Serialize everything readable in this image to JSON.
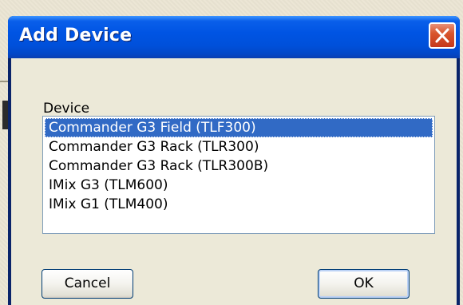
{
  "dialog": {
    "title": "Add Device",
    "field_label": "Device",
    "devices": [
      "Commander G3 Field (TLF300)",
      "Commander G3 Rack (TLR300)",
      "Commander G3 Rack (TLR300B)",
      "IMix G3 (TLM600)",
      "IMix G1 (TLM400)"
    ],
    "selected_device": "Commander G3 Field (TLF300)",
    "cancel_label": "Cancel",
    "ok_label": "OK"
  },
  "icons": {
    "close": "close-icon"
  },
  "colors": {
    "titlebar": "#0054e3",
    "selection": "#316ac5",
    "close_button": "#d9562d",
    "dialog_face": "#ece9d8"
  }
}
